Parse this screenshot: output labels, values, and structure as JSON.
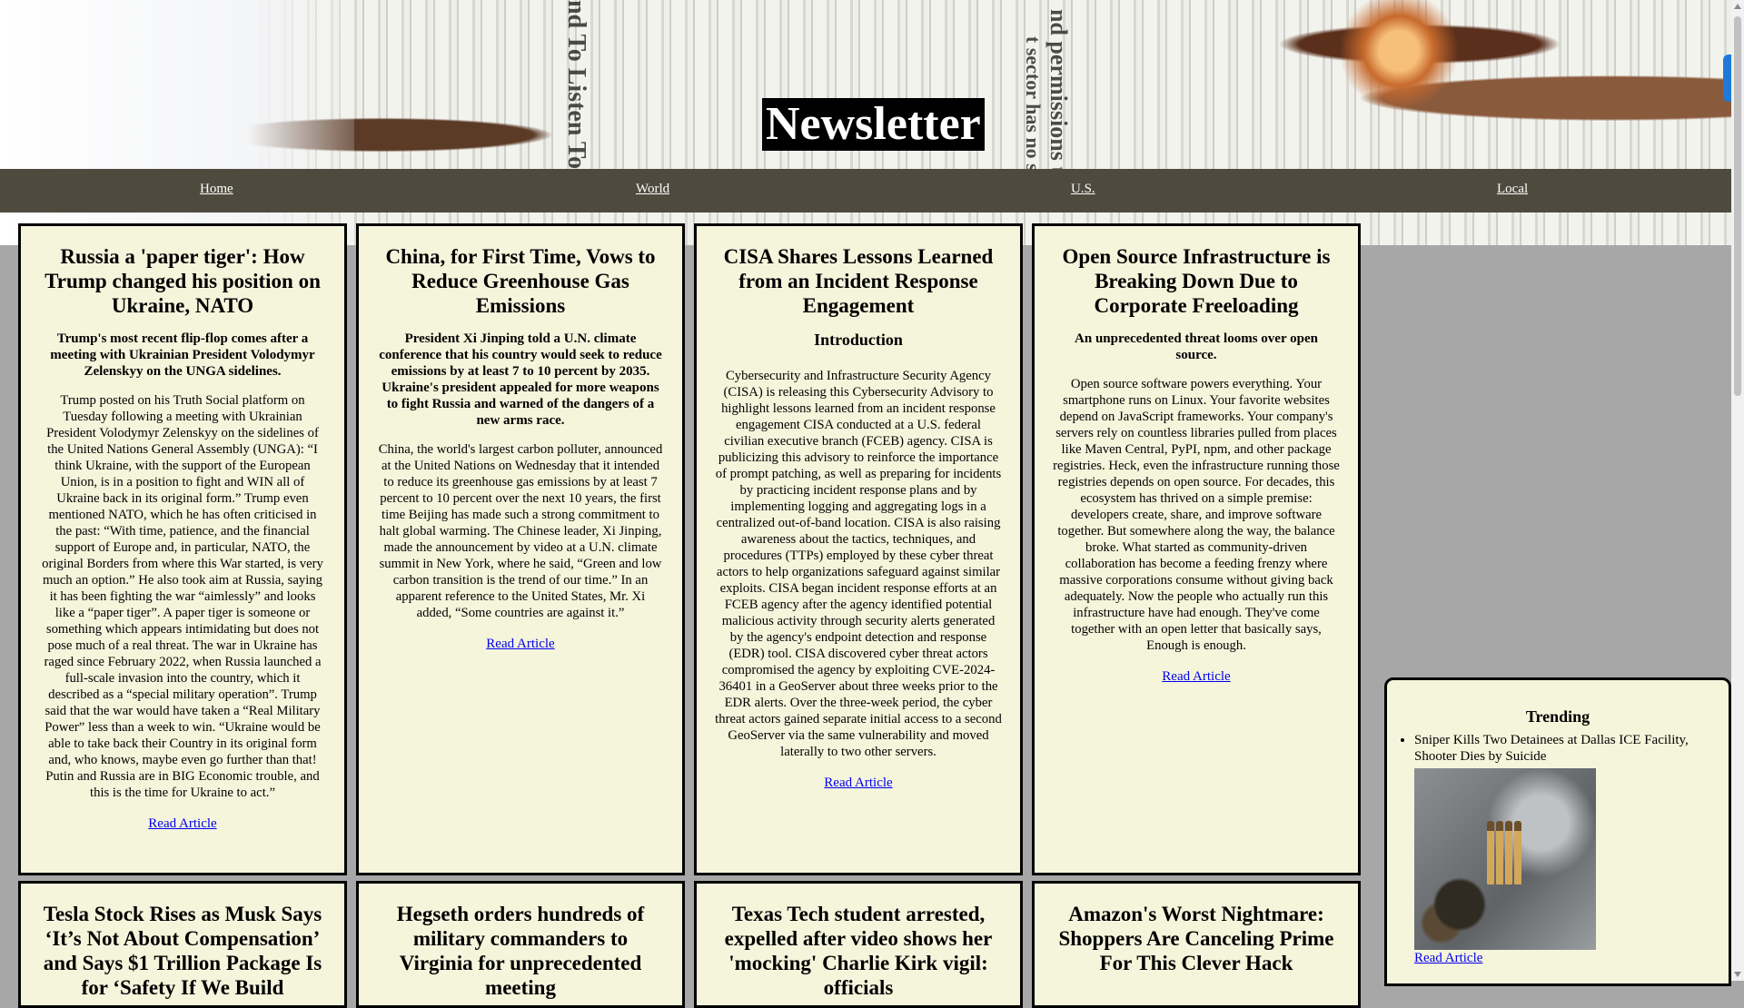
{
  "site": {
    "title": "Newsletter"
  },
  "nav": {
    "items": [
      "Home",
      "World",
      "U.S.",
      "Local"
    ]
  },
  "articles": [
    {
      "title": "Russia a 'paper tiger': How Trump changed his position on Ukraine, NATO",
      "subtitle": "Trump's most recent flip-flop comes after a meeting with Ukrainian President Volodymyr Zelenskyy on the UNGA sidelines.",
      "body": "Trump posted on his Truth Social platform on Tuesday following a meeting with Ukrainian President Volodymyr Zelenskyy on the sidelines of the United Nations General Assembly (UNGA): “I think Ukraine, with the support of the European Union, is in a position to fight and WIN all of Ukraine back in its original form.” Trump even mentioned NATO, which he has often criticised in the past: “With time, patience, and the financial support of Europe and, in particular, NATO, the original Borders from where this War started, is very much an option.” He also took aim at Russia, saying it has been fighting the war “aimlessly” and looks like a “paper tiger”. A paper tiger is someone or something which appears intimidating but does not pose much of a real threat. The war in Ukraine has raged since February 2022, when Russia launched a full-scale invasion into the country, which it described as a “special military operation”. Trump said that the war would have taken a “Real Military Power” less than a week to win. “Ukraine would be able to take back their Country in its original form and, who knows, maybe even go further than that! Putin and Russia are in BIG Economic trouble, and this is the time for Ukraine to act.”",
      "link": "Read Article"
    },
    {
      "title": "China, for First Time, Vows to Reduce Greenhouse Gas Emissions",
      "subtitle": "President Xi Jinping told a U.N. climate conference that his country would seek to reduce emissions by at least 7 to 10 percent by 2035. Ukraine's president appealed for more weapons to fight Russia and warned of the dangers of a new arms race.",
      "body": "China, the world's largest carbon polluter, announced at the United Nations on Wednesday that it intended to reduce its greenhouse gas emissions by at least 7 percent to 10 percent over the next 10 years, the first time Beijing has made such a strong commitment to halt global warming. The Chinese leader, Xi Jinping, made the announcement by video at a U.N. climate summit in New York, where he said, “Green and low carbon transition is the trend of our time.” In an apparent reference to the United States, Mr. Xi added, “Some countries are against it.”",
      "link": "Read Article"
    },
    {
      "title": "CISA Shares Lessons Learned from an Incident Response Engagement",
      "section": "Introduction",
      "body": "Cybersecurity and Infrastructure Security Agency (CISA) is releasing this Cybersecurity Advisory to highlight lessons learned from an incident response engagement CISA conducted at a U.S. federal civilian executive branch (FCEB) agency. CISA is publicizing this advisory to reinforce the importance of prompt patching, as well as preparing for incidents by practicing incident response plans and by implementing logging and aggregating logs in a centralized out-of-band location. CISA is also raising awareness about the tactics, techniques, and procedures (TTPs) employed by these cyber threat actors to help organizations safeguard against similar exploits. CISA began incident response efforts at an FCEB agency after the agency identified potential malicious activity through security alerts generated by the agency's endpoint detection and response (EDR) tool. CISA discovered cyber threat actors compromised the agency by exploiting CVE-2024-36401 in a GeoServer about three weeks prior to the EDR alerts. Over the three-week period, the cyber threat actors gained separate initial access to a second GeoServer via the same vulnerability and moved laterally to two other servers.",
      "link": "Read Article"
    },
    {
      "title": "Open Source Infrastructure is Breaking Down Due to Corporate Freeloading",
      "subtitle": "An unprecedented threat looms over open source.",
      "body": "Open source software powers everything. Your smartphone runs on Linux. Your favorite websites depend on JavaScript frameworks. Your company's servers rely on countless libraries pulled from places like Maven Central, PyPI, npm, and other package registries. Heck, even the infrastructure running those registries depends on open source. For decades, this ecosystem has thrived on a simple premise: developers create, share, and improve software together. But somewhere along the way, the balance broke. What started as community-driven collaboration has become a feeding frenzy where massive corporations consume without giving back adequately. Now the people who actually run this infrastructure have had enough. They've come together with an open letter that basically says, Enough is enough.",
      "link": "Read Article"
    },
    {
      "title": "Tesla Stock Rises as Musk Says ‘It’s Not About Compensation’ and Says $1 Trillion Package Is for ‘Safety If We Build"
    },
    {
      "title": "Hegseth orders hundreds of military commanders to Virginia for unprecedented meeting"
    },
    {
      "title": "Texas Tech student arrested, expelled after video shows her 'mocking' Charlie Kirk vigil: officials"
    },
    {
      "title": "Amazon's Worst Nightmare: Shoppers Are Canceling Prime For This Clever Hack"
    }
  ],
  "trending": {
    "heading": "Trending",
    "items": [
      {
        "text": "Sniper Kills Two Detainees at Dallas ICE Facility, Shooter Dies by Suicide",
        "image": "rifle-cartridges-on-rock",
        "link": "Read Article"
      }
    ]
  },
  "colors": {
    "page_bg": "#a7a7a7",
    "nav_bg": "#4e4b3e",
    "card_bg": "#f5f5dc",
    "link": "#0000ee",
    "title_bg": "#000000"
  }
}
